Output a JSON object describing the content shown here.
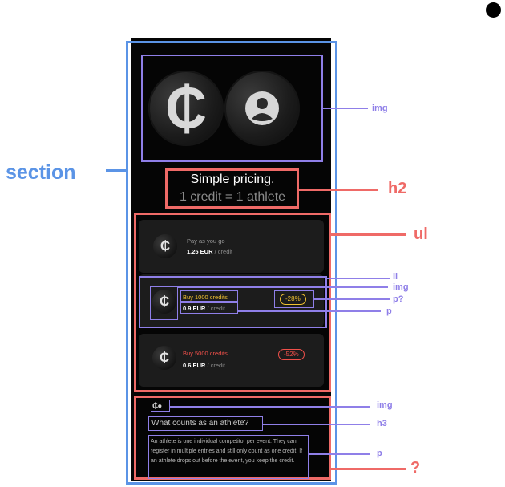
{
  "hero": {
    "coin_symbol": "₵",
    "icon_left": "credit-coin-icon",
    "icon_right": "athlete-avatar-icon"
  },
  "heading": {
    "title": "Simple pricing.",
    "subtitle": "1 credit = 1 athlete"
  },
  "pricing": {
    "items": [
      {
        "title": "Pay as you go",
        "price": "1.25 EUR",
        "unit": " / credit",
        "badge": "",
        "accent": "#9a9a9a"
      },
      {
        "title": "Buy 1000 credits",
        "price": "0.9 EUR",
        "unit": " / credit",
        "badge": "-28%",
        "accent": "#f2c230"
      },
      {
        "title": "Buy 5000 credits",
        "price": "0.6 EUR",
        "unit": " / credit",
        "badge": "-52%",
        "accent": "#f0504a"
      }
    ]
  },
  "faq": {
    "icons": "₵●",
    "question": "What counts as an athlete?",
    "answer": "An athlete is one individual competitor per event. They can register in multiple entries and still only count as one credit. If an athlete drops out before the event, you keep the credit."
  },
  "annotations": {
    "section": "section",
    "h2": "h2",
    "ul": "ul",
    "img": "img",
    "li": "li",
    "p_question": "p?",
    "p": "p",
    "h3": "h3",
    "question_mark": "?"
  },
  "colors": {
    "section_box": "#5b94e6",
    "tag_red": "#ef6a67",
    "tag_purple": "#8f7fe8",
    "panel_bg": "#050505",
    "card_bg": "#1c1c1c"
  }
}
